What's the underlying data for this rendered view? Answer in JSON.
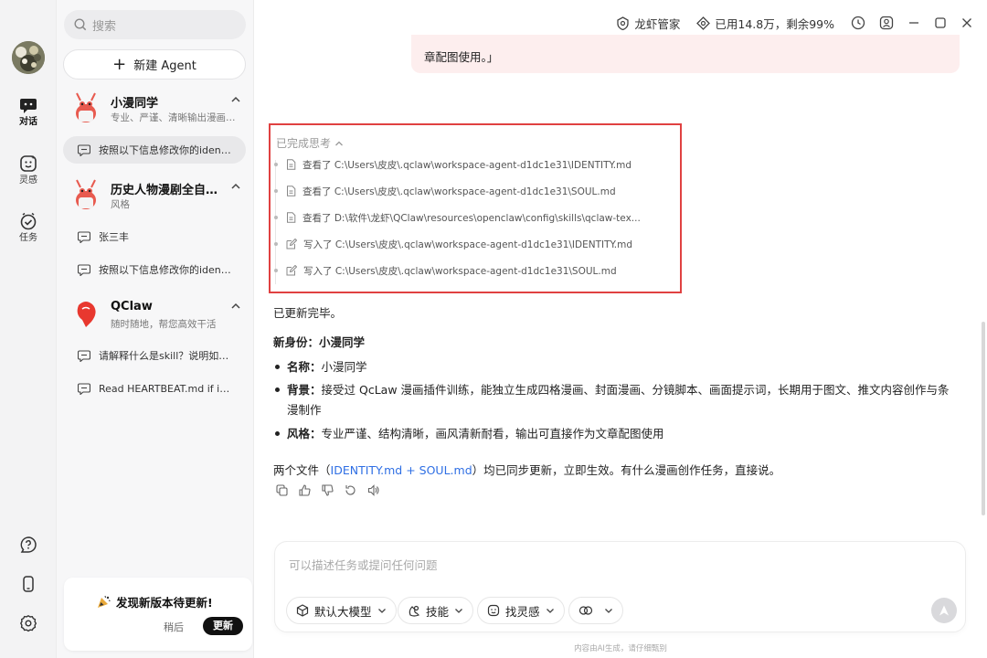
{
  "rail": {
    "items": [
      {
        "label": "对话",
        "icon": "chat-icon"
      },
      {
        "label": "灵感",
        "icon": "inspiration-icon"
      },
      {
        "label": "任务",
        "icon": "task-icon"
      }
    ],
    "bottom_icons": [
      "help-icon",
      "phone-icon",
      "settings-icon"
    ]
  },
  "panel": {
    "search_placeholder": "搜索",
    "new_agent_label": "新建 Agent",
    "agents": [
      {
        "name": "小漫同学",
        "desc": "专业、严谨、清晰输出漫画…",
        "conversations": [
          "按照以下信息修改你的iden…"
        ]
      },
      {
        "name": "历史人物漫剧全自…",
        "desc": "风格",
        "conversations": [
          "张三丰",
          "按照以下信息修改你的iden…"
        ]
      },
      {
        "name": "QClaw",
        "desc": "随时随地，帮您高效干活",
        "conversations": [
          "请解释什么是skill？说明如…",
          "Read HEARTBEAT.md if it …"
        ]
      }
    ],
    "update": {
      "title": "发现新版本待更新!",
      "later": "稍后",
      "update_button": "更新"
    }
  },
  "topbar": {
    "manager": "龙虾管家",
    "usage": "已用14.8万，剩余99%"
  },
  "chat": {
    "prev_bubble_tail": "章配图使用。」",
    "thinking": {
      "header": "已完成思考",
      "steps": [
        {
          "action": "查看了",
          "path": "C:\\Users\\皮皮\\.qclaw\\workspace-agent-d1dc1e31\\IDENTITY.md",
          "icon": "file-icon"
        },
        {
          "action": "查看了",
          "path": "C:\\Users\\皮皮\\.qclaw\\workspace-agent-d1dc1e31\\SOUL.md",
          "icon": "file-icon"
        },
        {
          "action": "查看了",
          "path": "D:\\软件\\龙虾\\QClaw\\resources\\openclaw\\config\\skills\\qclaw-tex...",
          "icon": "file-icon"
        },
        {
          "action": "写入了",
          "path": "C:\\Users\\皮皮\\.qclaw\\workspace-agent-d1dc1e31\\IDENTITY.md",
          "icon": "edit-icon"
        },
        {
          "action": "写入了",
          "path": "C:\\Users\\皮皮\\.qclaw\\workspace-agent-d1dc1e31\\SOUL.md",
          "icon": "edit-icon"
        }
      ]
    },
    "answer": {
      "done": "已更新完毕。",
      "identity_heading": "新身份：小漫同学",
      "bullets": [
        {
          "label": "名称",
          "text": "小漫同学"
        },
        {
          "label": "背景",
          "text": "接受过 QcLaw 漫画插件训练，能独立生成四格漫画、封面漫画、分镜脚本、画面提示词，长期用于图文、推文内容创作与条漫制作"
        },
        {
          "label": "风格",
          "text": "专业严谨、结构清晰，画风清新耐看，输出可直接作为文章配图使用"
        }
      ],
      "files_prefix": "两个文件（",
      "file1": "IDENTITY.md",
      "plus": " + ",
      "file2": "SOUL.md",
      "files_suffix": "）均已同步更新，立即生效。有什么漫画创作任务，直接说。",
      "colon": "："
    }
  },
  "input": {
    "placeholder": "可以描述任务或提问任何问题",
    "chips": [
      "默认大模型",
      "技能",
      "找灵感"
    ],
    "footer": "内容由AI生成，请仔细甄别"
  },
  "colors": {
    "highlight_border": "#e04141",
    "link": "#2f6fe4",
    "pink_bubble": "#fdeeee"
  }
}
